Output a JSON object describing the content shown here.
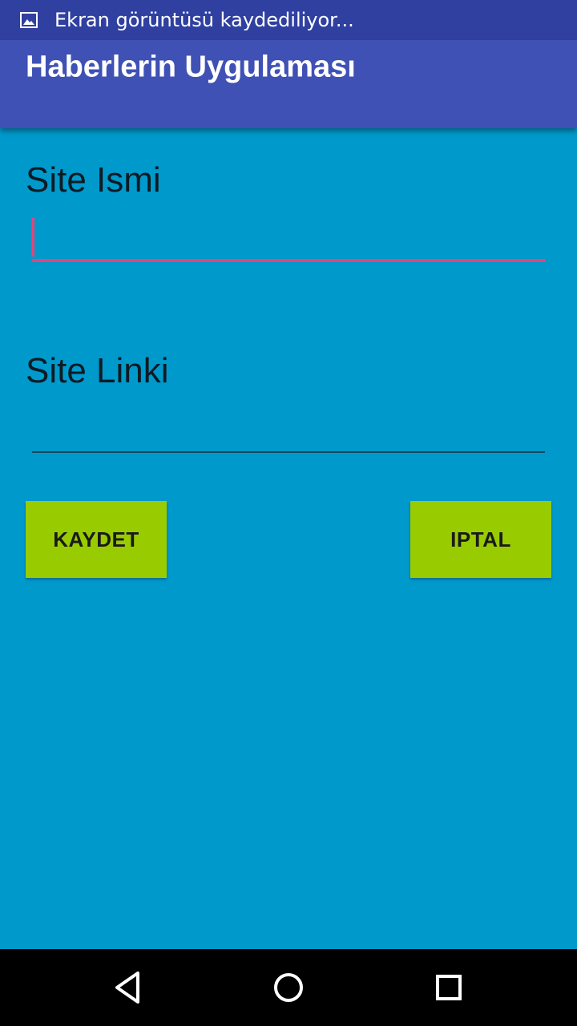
{
  "status_bar": {
    "notification_icon": "image-icon",
    "text": "Ekran görüntüsü kaydediliyor..."
  },
  "app_bar": {
    "title": "Haberlerin Uygulaması"
  },
  "form": {
    "site_name_label": "Site Ismi",
    "site_name_value": "",
    "site_link_label": "Site Linki",
    "site_link_value": ""
  },
  "buttons": {
    "save_label": "KAYDET",
    "cancel_label": "IPTAL"
  },
  "nav_bar": {
    "back_icon": "back-triangle-icon",
    "home_icon": "home-circle-icon",
    "recents_icon": "recents-square-icon"
  },
  "colors": {
    "background": "#0099cc",
    "status_bar": "#3040a0",
    "app_bar": "#3f51b5",
    "button": "#99cc00",
    "accent": "#e5457a"
  }
}
